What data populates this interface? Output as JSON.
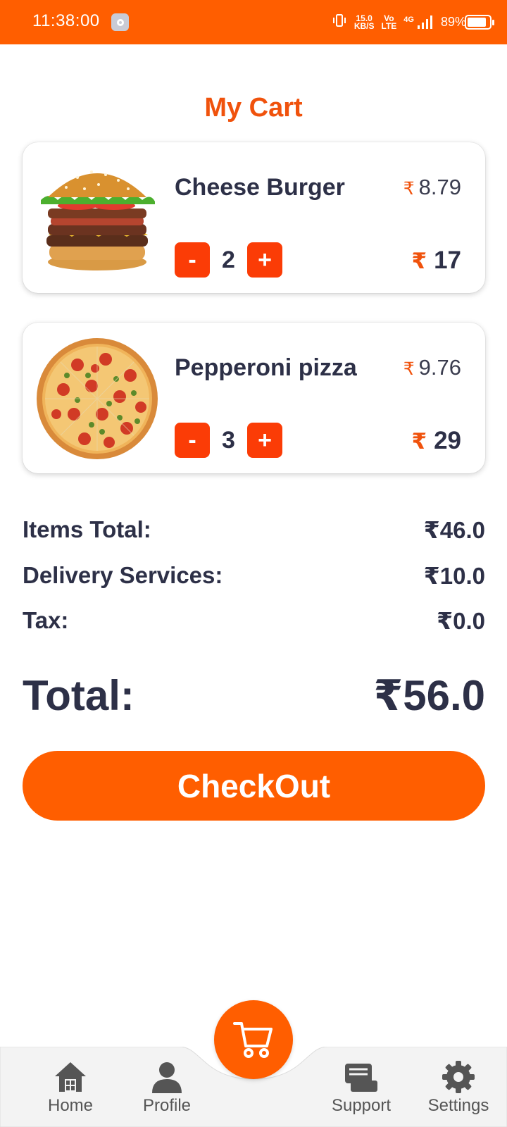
{
  "status_bar": {
    "time": "11:38:00",
    "network_speed_value": "15.0",
    "network_speed_unit": "KB/S",
    "volte_top": "Vo",
    "volte_bottom": "LTE",
    "network_type": "4G",
    "battery_percent": "89%",
    "battery_level": 0.89
  },
  "header": {
    "title": "My Cart"
  },
  "currency_symbol": "₹",
  "cart_items": [
    {
      "name": "Cheese Burger",
      "unit_price": "8.79",
      "quantity": "2",
      "line_total": "17",
      "image_icon": "burger-image"
    },
    {
      "name": "Pepperoni pizza",
      "unit_price": "9.76",
      "quantity": "3",
      "line_total": "29",
      "image_icon": "pizza-image"
    }
  ],
  "qty_controls": {
    "minus_label": "-",
    "plus_label": "+"
  },
  "summary": {
    "items_total_label": "Items Total:",
    "items_total_value": "₹46.0",
    "delivery_label": "Delivery Services:",
    "delivery_value": "₹10.0",
    "tax_label": "Tax:",
    "tax_value": "₹0.0",
    "total_label": "Total:",
    "total_value": "₹56.0"
  },
  "checkout": {
    "label": "CheckOut"
  },
  "bottom_nav": {
    "items": [
      {
        "label": "Home",
        "icon": "home-icon"
      },
      {
        "label": "Profile",
        "icon": "person-icon"
      },
      {
        "label": "Support",
        "icon": "chat-icon"
      },
      {
        "label": "Settings",
        "icon": "gear-icon"
      }
    ],
    "center_button_icon": "cart-icon"
  },
  "colors": {
    "brand_orange": "#ff5e00",
    "title_orange": "#f0520c",
    "qty_button_red": "#fb3c06",
    "text_dark": "#2d3047",
    "nav_background": "#f3f3f3"
  }
}
